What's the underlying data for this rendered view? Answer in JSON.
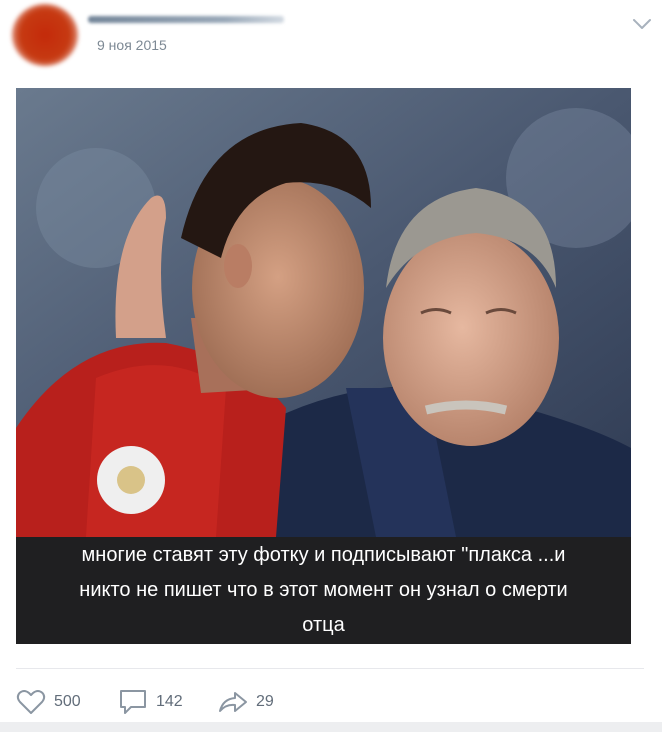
{
  "post": {
    "date": "9 ноя 2015",
    "caption": [
      "многие ставят эту фотку и подписывают \"плакса ...и",
      "никто не пишет что в этот момент он узнал о смерти",
      "отца"
    ]
  },
  "actions": {
    "likes": "500",
    "comments": "142",
    "shares": "29"
  },
  "icons": {
    "like": "heart-icon",
    "comment": "comment-icon",
    "share": "share-icon",
    "menu": "chevron-down-icon"
  },
  "colors": {
    "meta_text": "#7d8994",
    "action_text": "#626d7a",
    "caption_bg": "#1f1f21"
  }
}
